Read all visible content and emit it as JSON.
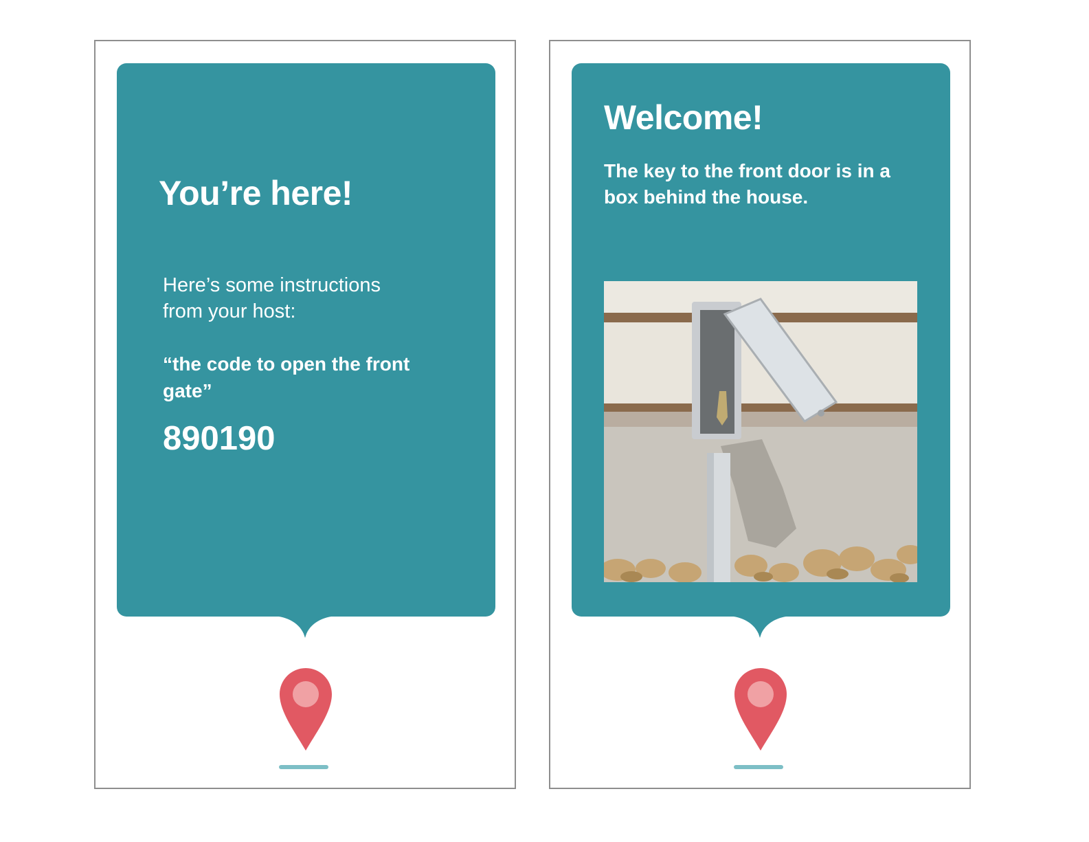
{
  "screens": [
    {
      "title": "You’re here!",
      "intro": "Here’s some instructions from your host:",
      "quote": "“the code to open the front gate”",
      "code": "890190"
    },
    {
      "title": "Welcome!",
      "message": "The key to the front door is in a box behind the house.",
      "image_subject": "open electrical box with key mounted on pipe against wall"
    }
  ],
  "icons": {
    "pin": "location-pin-icon"
  },
  "colors": {
    "card": "#3594a0",
    "pin": "#e15963",
    "pin_dot": "#f0a1a4",
    "home_bar": "#7dbfc6",
    "frame_border": "#8e8e8e"
  }
}
